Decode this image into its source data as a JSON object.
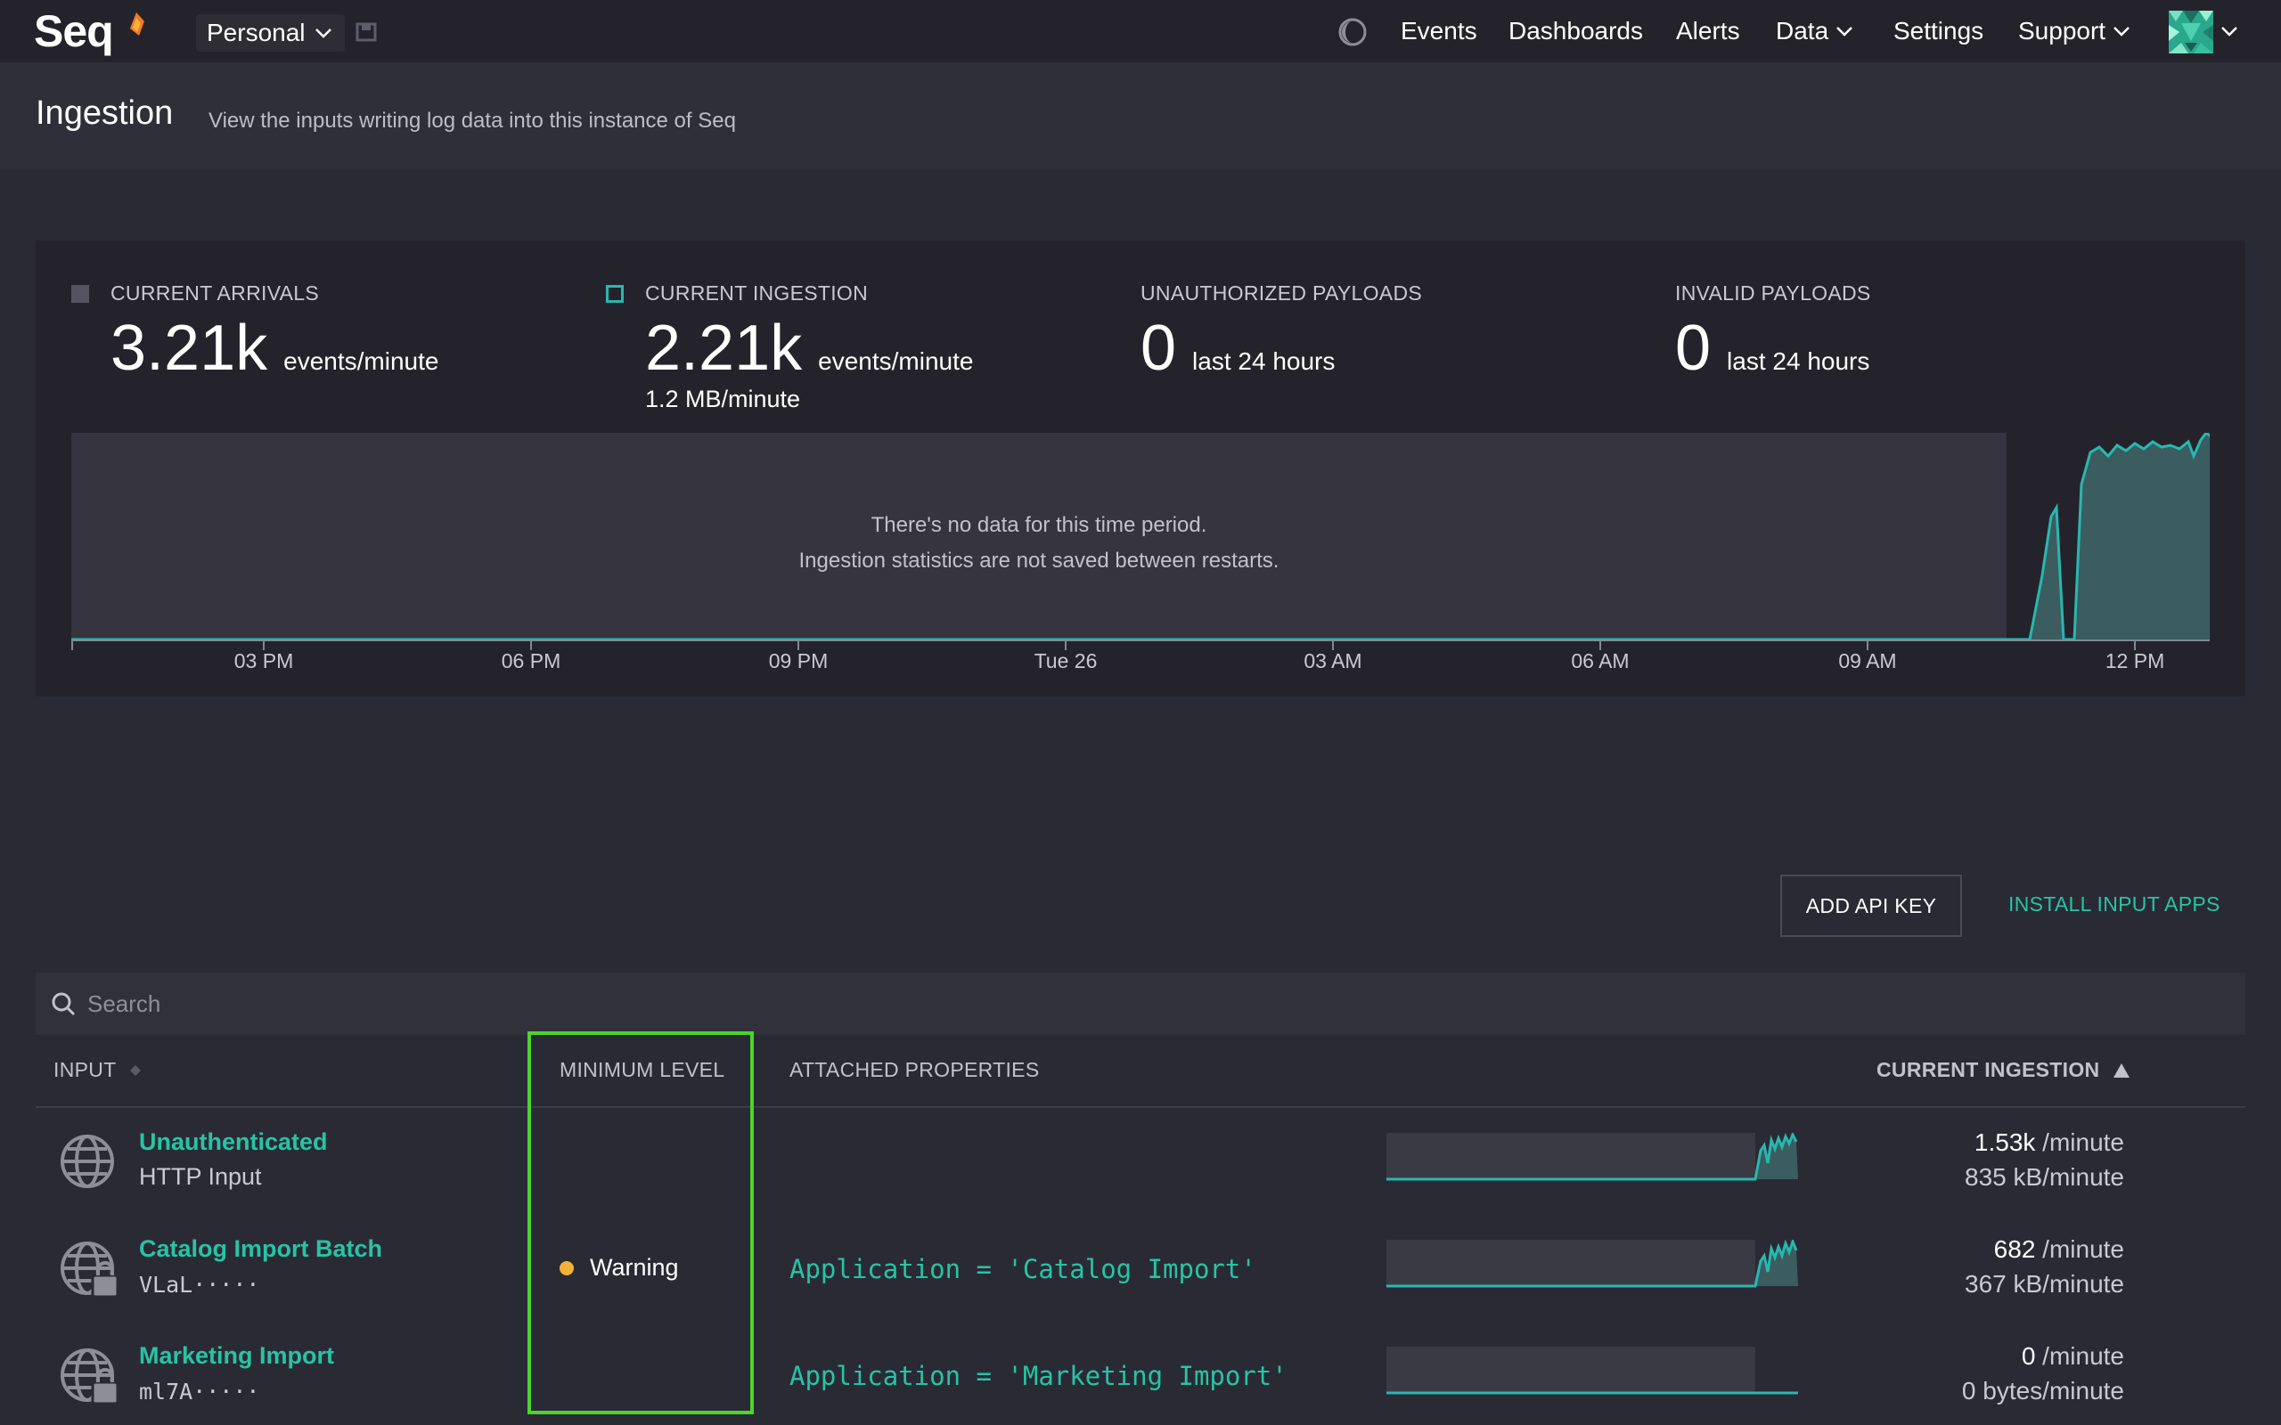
{
  "app": {
    "logo_text": "Seq",
    "workspace": "Personal"
  },
  "nav": {
    "events": "Events",
    "dashboards": "Dashboards",
    "alerts": "Alerts",
    "data": "Data",
    "settings": "Settings",
    "support": "Support"
  },
  "header": {
    "title": "Ingestion",
    "subtitle": "View the inputs writing log data into this instance of Seq"
  },
  "stats": {
    "arrivals": {
      "label": "CURRENT ARRIVALS",
      "value": "3.21k",
      "unit": "events/minute"
    },
    "ingestion": {
      "label": "CURRENT INGESTION",
      "value": "2.21k",
      "unit": "events/minute",
      "sub": "1.2 MB/minute"
    },
    "unauthorized": {
      "label": "UNAUTHORIZED PAYLOADS",
      "value": "0",
      "unit": "last 24 hours"
    },
    "invalid": {
      "label": "INVALID PAYLOADS",
      "value": "0",
      "unit": "last 24 hours"
    }
  },
  "chart_data": {
    "type": "area",
    "x_ticks": [
      "03 PM",
      "06 PM",
      "09 PM",
      "Tue 26",
      "03 AM",
      "06 AM",
      "09 AM",
      "12 PM"
    ],
    "empty_message_line1": "There's no data for this time period.",
    "empty_message_line2": "Ingestion statistics are not saved between restarts.",
    "grid": false,
    "colors": {
      "line": "#27b8b0",
      "fill": "#3c5d5f",
      "empty": "#35343f"
    }
  },
  "actions": {
    "add_api_key": "ADD API KEY",
    "install_input_apps": "INSTALL INPUT APPS"
  },
  "search": {
    "placeholder": "Search"
  },
  "table": {
    "headers": {
      "input": "INPUT",
      "minimum_level": "MINIMUM LEVEL",
      "attached_properties": "ATTACHED PROPERTIES",
      "current_ingestion": "CURRENT INGESTION"
    },
    "rows": [
      {
        "name": "Unauthenticated",
        "sub": "HTTP Input",
        "level": "",
        "property": "",
        "rate": "1.53k",
        "rate_unit": "/minute",
        "bytes": "835 kB/minute",
        "icon": "globe-icon"
      },
      {
        "name": "Catalog Import Batch",
        "sub": "VLaL·····",
        "level": "Warning",
        "property": "Application = 'Catalog Import'",
        "rate": "682",
        "rate_unit": "/minute",
        "bytes": "367 kB/minute",
        "icon": "globe-lock-icon"
      },
      {
        "name": "Marketing Import",
        "sub": "ml7A·····",
        "level": "",
        "property": "Application = 'Marketing Import'",
        "rate": "0",
        "rate_unit": "/minute",
        "bytes": "0 bytes/minute",
        "icon": "globe-lock-icon"
      }
    ]
  },
  "colors": {
    "accent": "#27c4a4",
    "warning": "#f4b13a",
    "highlight": "#4ad62a"
  }
}
